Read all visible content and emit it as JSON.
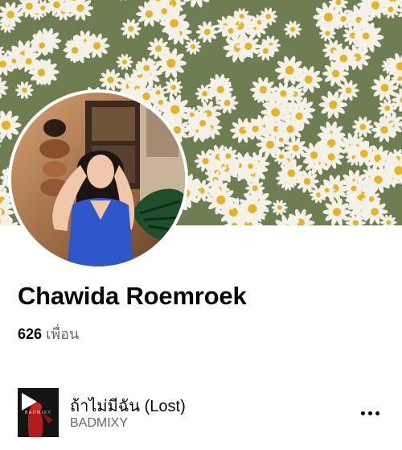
{
  "profile": {
    "name": "Chawida Roemroek",
    "friends_count": "626",
    "friends_label": "เพื่อน"
  },
  "cover_photo": {
    "subject": "daisy-field",
    "accent": "#f4f2e8"
  },
  "profile_picture": {
    "subject": "woman-in-blue-top"
  },
  "music": {
    "song_title": "ถ้าไม่มีฉัน (Lost)",
    "artist": "BADMIXY",
    "album_art_text": "BADMIXY",
    "more_icon": "more-horizontal-icon"
  },
  "colors": {
    "primary_text": "#050505",
    "secondary_text": "#65676b"
  }
}
